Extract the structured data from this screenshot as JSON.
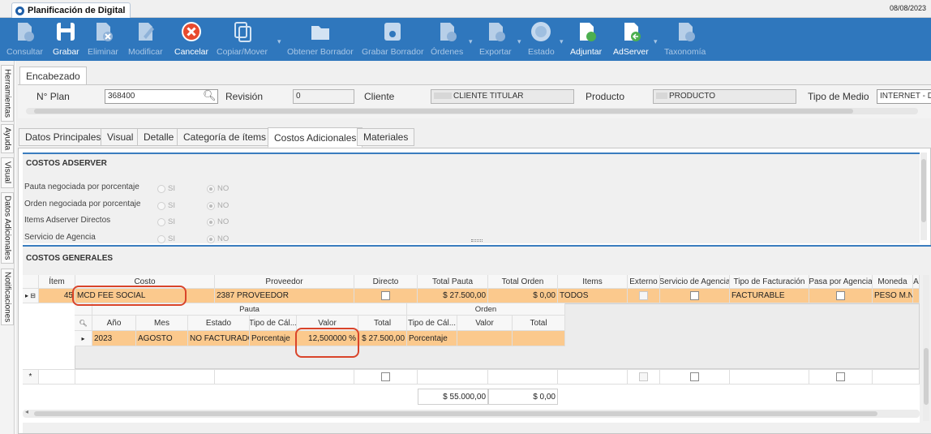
{
  "window": {
    "title": "Planificación de Digital",
    "date": "08/08/2023"
  },
  "toolbar": [
    {
      "label": "Consultar",
      "icon": "consult-icon",
      "enabled": false
    },
    {
      "label": "Grabar",
      "icon": "save-icon",
      "enabled": true
    },
    {
      "label": "Eliminar",
      "icon": "delete-icon",
      "enabled": false
    },
    {
      "label": "Modificar",
      "icon": "edit-icon",
      "enabled": false
    },
    {
      "label": "Cancelar",
      "icon": "cancel-icon",
      "enabled": true
    },
    {
      "label": "Copiar/Mover",
      "icon": "copy-icon",
      "enabled": false
    },
    {
      "label": "Obtener Borrador",
      "icon": "folder-icon",
      "enabled": false
    },
    {
      "label": "Grabar Borrador",
      "icon": "save-draft-icon",
      "enabled": false
    },
    {
      "label": "Órdenes",
      "icon": "orders-icon",
      "enabled": false
    },
    {
      "label": "Exportar",
      "icon": "export-icon",
      "enabled": false
    },
    {
      "label": "Estado",
      "icon": "status-icon",
      "enabled": false
    },
    {
      "label": "Adjuntar",
      "icon": "attach-icon",
      "enabled": true
    },
    {
      "label": "AdServer",
      "icon": "adserver-icon",
      "enabled": true
    },
    {
      "label": "Taxonomía",
      "icon": "taxonomy-icon",
      "enabled": false
    }
  ],
  "side_tabs": [
    "Herramientas",
    "Ayuda",
    "Visual",
    "Datos Adicionales",
    "Notificaciones"
  ],
  "header_tab": "Encabezado",
  "header": {
    "plan_label": "N° Plan",
    "plan_value": "368400",
    "revision_label": "Revisión",
    "revision_value": "0",
    "cliente_label": "Cliente",
    "cliente_value": "CLIENTE TITULAR",
    "producto_label": "Producto",
    "producto_value": "PRODUCTO",
    "medio_label": "Tipo de Medio",
    "medio_value": "INTERNET - DIG"
  },
  "tabs": [
    "Datos Principales",
    "Visual",
    "Detalle",
    "Categoría de ítems",
    "Costos Adicionales",
    "Materiales"
  ],
  "active_tab": "Costos Adicionales",
  "costos_adserver": {
    "title": "COSTOS ADSERVER",
    "options": [
      {
        "label": "Pauta negociada por porcentaje",
        "selected": "NO"
      },
      {
        "label": "Orden negociada por porcentaje",
        "selected": "NO"
      },
      {
        "label": "Items Adserver Directos",
        "selected": "NO"
      },
      {
        "label": "Servicio de Agencia",
        "selected": "NO"
      }
    ],
    "yes_label": "SI",
    "no_label": "NO"
  },
  "costos_generales": {
    "title": "COSTOS GENERALES",
    "columns": [
      "Ítem",
      "Costo",
      "Proveedor",
      "Directo",
      "Total Pauta",
      "Total Orden",
      "Items",
      "Externo",
      "Servicio de Agencia",
      "Tipo de Facturación",
      "Pasa por Agencia",
      "Moneda",
      "A"
    ],
    "row": {
      "item": "45",
      "costo": "MCD FEE SOCIAL",
      "proveedor": "2387 PROVEEDOR",
      "total_pauta": "$ 27.500,00",
      "total_orden": "$ 0,00",
      "items": "TODOS",
      "tipo_facturacion": "FACTURABLE",
      "moneda": "PESO M.N."
    },
    "detail": {
      "group_pauta": "Pauta",
      "group_orden": "Orden",
      "columns": [
        "Año",
        "Mes",
        "Estado",
        "Tipo de Cál...",
        "Valor",
        "Total",
        "Tipo de Cál...",
        "Valor",
        "Total"
      ],
      "row": [
        "2023",
        "AGOSTO",
        "NO FACTURADO",
        "Porcentaje",
        "12,500000 %",
        "$ 27.500,00",
        "Porcentaje",
        "",
        ""
      ]
    },
    "totals": {
      "total_pauta": "$ 55.000,00",
      "total_orden": "$ 0,00"
    }
  }
}
